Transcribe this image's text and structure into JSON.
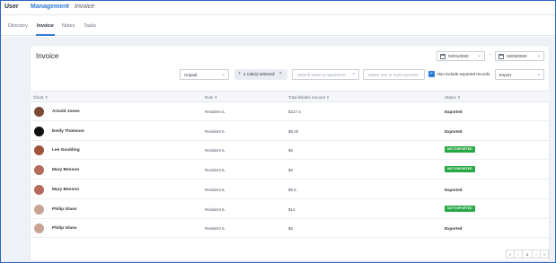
{
  "header": {
    "app_title": "User",
    "breadcrumb_main": "Management",
    "breadcrumb_sep": "›",
    "breadcrumb_current": "Invoice"
  },
  "tabs": [
    {
      "label": "Directory"
    },
    {
      "label": "Invoice"
    },
    {
      "label": "Notes"
    },
    {
      "label": "Tasks"
    }
  ],
  "page": {
    "title": "Invoice",
    "date_from": "02/01/2020",
    "date_sep": "-",
    "date_to": "02/03/2020"
  },
  "filters": {
    "status_select": "Unpaid",
    "roles_chip": "4 role(s) selected",
    "chip_plus": "+",
    "chip_remove": "×",
    "search_placeholder": "Search name or apartment",
    "select_placeholder": "Select one or more services",
    "include_exported_label": "Also include exported records",
    "include_exported_checked": true,
    "checkmark": "✓",
    "export_label": "Export"
  },
  "table": {
    "columns": [
      "Client ⇕",
      "Role ⇕",
      "Total billable amount ⇕",
      "Status ⇕"
    ],
    "rows": [
      {
        "name": "Arnold Jones",
        "role": "Resident IL",
        "amount": "$317.5",
        "status": "Exported",
        "badge": false,
        "avatar_color": "#7a4a35"
      },
      {
        "name": "Emily Thomson",
        "role": "Resident IL",
        "amount": "$9.25",
        "status": "Exported",
        "badge": false,
        "avatar_color": "#111111"
      },
      {
        "name": "Lee Goulding",
        "role": "Resident IL",
        "amount": "$5",
        "status": "NOT EXPORTED",
        "badge": true,
        "avatar_color": "#a0523d"
      },
      {
        "name": "Mary Benson",
        "role": "Resident IL",
        "amount": "$5",
        "status": "NOT EXPORTED",
        "badge": true,
        "avatar_color": "#b56a5c"
      },
      {
        "name": "Mary Benson",
        "role": "Resident IL",
        "amount": "$8.5",
        "status": "Exported",
        "badge": false,
        "avatar_color": "#b56a5c"
      },
      {
        "name": "Philip Glass",
        "role": "Resident IL",
        "amount": "$14",
        "status": "NOT EXPORTED",
        "badge": true,
        "avatar_color": "#c9a393"
      },
      {
        "name": "Philip Glass",
        "role": "Resident IL",
        "amount": "$5",
        "status": "Exported",
        "badge": false,
        "avatar_color": "#c9a393"
      }
    ]
  },
  "pagination": {
    "first": "«",
    "prev": "‹",
    "current": "1",
    "next": "›",
    "last": "»"
  },
  "colors": {
    "accent": "#2f7ad8",
    "badge_green": "#27a844"
  }
}
